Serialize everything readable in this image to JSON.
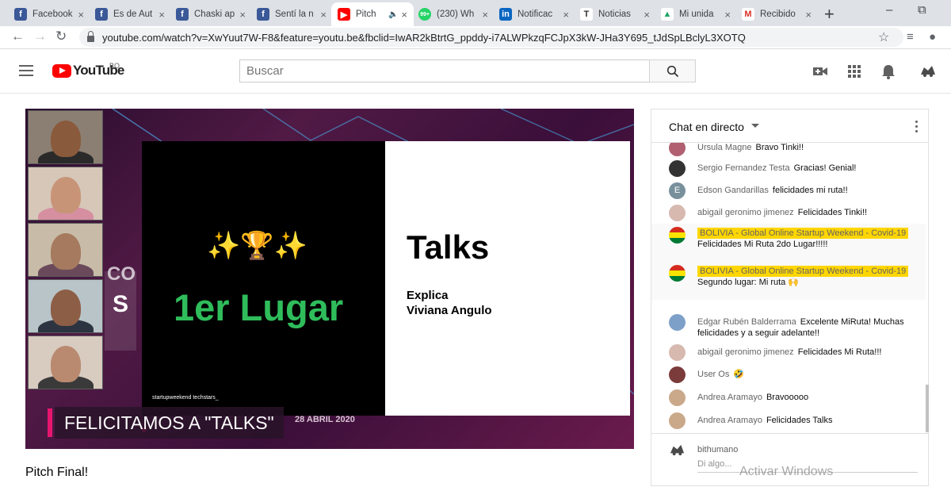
{
  "browser": {
    "tabs": [
      {
        "label": "Facebook",
        "favicon": "facebook-icon",
        "color": "#3b5998",
        "glyph": "f"
      },
      {
        "label": "Es de Aut",
        "favicon": "facebook-icon",
        "color": "#3b5998",
        "glyph": "f"
      },
      {
        "label": "Chaski ap",
        "favicon": "facebook-icon",
        "color": "#3b5998",
        "glyph": "f"
      },
      {
        "label": "Sentí la n",
        "favicon": "facebook-icon",
        "color": "#3b5998",
        "glyph": "f"
      },
      {
        "label": "Pitch",
        "favicon": "youtube-icon",
        "color": "#ff0000",
        "glyph": "▶",
        "active": true
      },
      {
        "label": "(230) Wh",
        "favicon": "whatsapp-icon",
        "color": "#25d366",
        "glyph": "99+"
      },
      {
        "label": "Notificac",
        "favicon": "linkedin-icon",
        "color": "#0a66c2",
        "glyph": "in"
      },
      {
        "label": "Noticias",
        "favicon": "nyt-icon",
        "color": "#ffffff",
        "glyph": "T"
      },
      {
        "label": "Mi unida",
        "favicon": "google-drive-icon",
        "color": "#ffffff",
        "glyph": "▲"
      },
      {
        "label": "Recibido",
        "favicon": "gmail-icon",
        "color": "#ffffff",
        "glyph": "M"
      }
    ],
    "url": "youtube.com/watch?v=XwYuut7W-F8&feature=youtu.be&fbclid=IwAR2kBtrtG_ppddy-i7ALWPkzqFCJpX3kW-JHa3Y695_tJdSpLBclyL3XOTQ"
  },
  "youtube": {
    "logo_text": "YouTube",
    "country_code": "BO",
    "search_placeholder": "Buscar"
  },
  "video": {
    "slide_left_sparkles": "✨🏆✨",
    "slide_left_title": "1er Lugar",
    "slide_right_title": "Talks",
    "slide_right_line1": "Explica",
    "slide_right_line2": "Viviana Angulo",
    "lower_third": "FELICITAMOS A \"TALKS\"",
    "date_text": "28 ABRIL 2020",
    "brand_text": "startupweekend  techstars_",
    "side_text_1": "CO",
    "side_text_2": "S"
  },
  "video_title": "Pitch Final!",
  "chat": {
    "title": "Chat en directo",
    "messages": [
      {
        "author": "Ursula Magne",
        "text": "Bravo Tinki!!",
        "avatar_color": "#b06070"
      },
      {
        "author": "Sergio Fernandez Testa",
        "text": "Gracias! Genial!",
        "avatar_color": "#333333"
      },
      {
        "author": "Edson Gandarillas",
        "text": "felicidades mi ruta!!",
        "avatar_color": "#78909c",
        "initial": "E"
      },
      {
        "author": "abigail geronimo jimenez",
        "text": "Felicidades Tinki!!",
        "avatar_color": "#d7b9b0"
      },
      {
        "author": "BOLIVIA - Global Online Startup Weekend - Covid-19",
        "text": "Felicidades Mi Ruta 2do Lugar!!!!!",
        "avatar_color": "#d52b1e",
        "highlight": true
      },
      {
        "author": "BOLIVIA - Global Online Startup Weekend - Covid-19",
        "text": "Segundo lugar: Mi ruta 🙌",
        "avatar_color": "#d52b1e",
        "highlight": true
      },
      {
        "author": "Edgar Rubén Balderrama",
        "text": "Excelente MiRuta! Muchas felicidades y a seguir adelante!!",
        "avatar_color": "#7da0c8"
      },
      {
        "author": "abigail geronimo jimenez",
        "text": "Felicidades Mi Ruta!!!",
        "avatar_color": "#d7b9b0"
      },
      {
        "author": "User Os",
        "text": "🤣",
        "avatar_color": "#7b3b3b"
      },
      {
        "author": "Andrea Aramayo",
        "text": "Bravooooo",
        "avatar_color": "#c9a98a"
      },
      {
        "author": "Andrea Aramayo",
        "text": "Felicidades Talks",
        "avatar_color": "#c9a98a"
      }
    ],
    "current_user": "bithumano",
    "input_placeholder": "Di algo..."
  },
  "watermark": "Activar Windows"
}
